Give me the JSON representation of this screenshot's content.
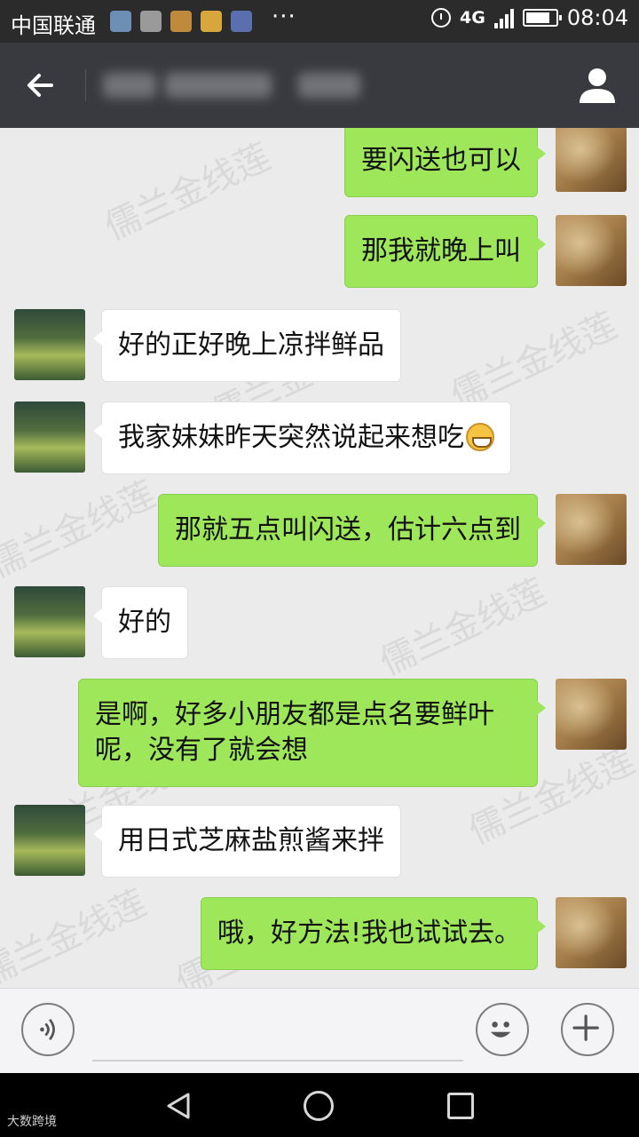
{
  "status_bar": {
    "carrier": "中国联通",
    "network_type": "4G",
    "time": "08:04",
    "dots": "···"
  },
  "messages": [
    {
      "side": "me",
      "text": "要闪送也可以"
    },
    {
      "side": "me",
      "text": "那我就晚上叫"
    },
    {
      "side": "them",
      "text": "好的正好晚上凉拌鲜品"
    },
    {
      "side": "them",
      "text": "我家妹妹昨天突然说起来想吃",
      "emoji": "grinning-face"
    },
    {
      "side": "me",
      "text": "那就五点叫闪送，估计六点到"
    },
    {
      "side": "them",
      "text": "好的"
    },
    {
      "side": "me",
      "text": "是啊，好多小朋友都是点名要鲜叶呢，没有了就会想"
    },
    {
      "side": "them",
      "text": "用日式芝麻盐煎酱来拌"
    },
    {
      "side": "me",
      "text": "哦，好方法!我也试试去。"
    }
  ],
  "watermark": "儒兰金线莲",
  "corner_mark": "大数跨境",
  "colors": {
    "my_bubble": "#9ee75a",
    "their_bubble": "#ffffff",
    "title_bar": "#393a3f",
    "chat_bg": "#ebebeb"
  }
}
